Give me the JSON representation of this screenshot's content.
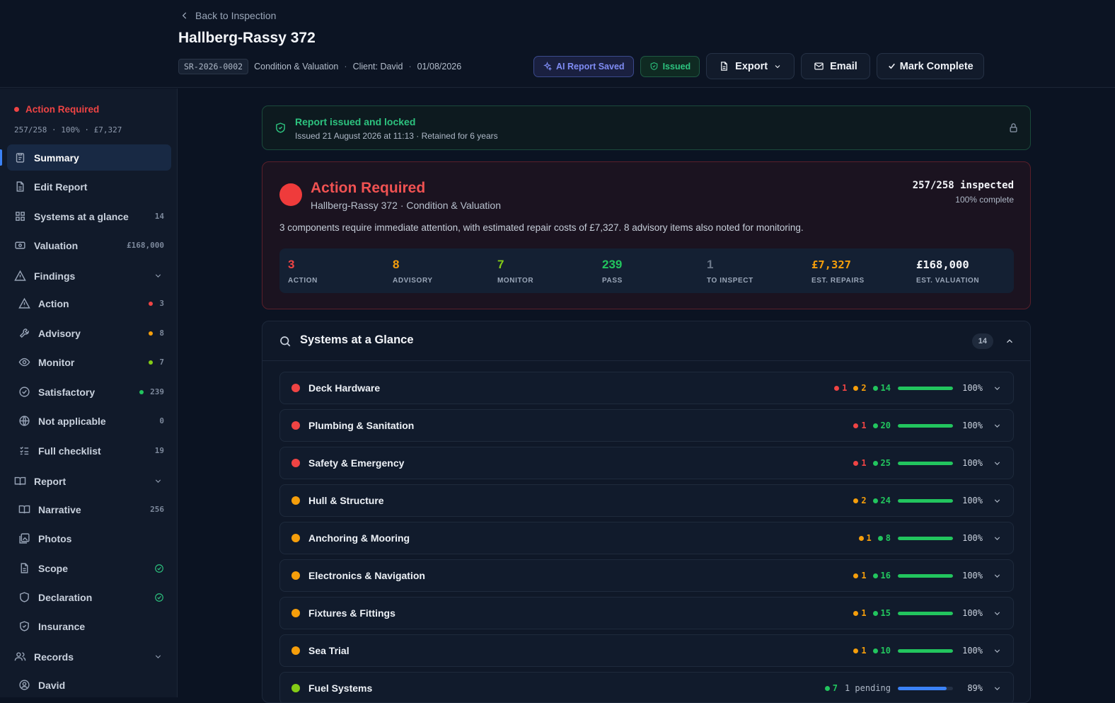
{
  "header": {
    "back_label": "Back to Inspection",
    "title": "Hallberg-Rassy 372",
    "ref": "SR-2026-0002",
    "type": "Condition & Valuation",
    "client": "Client: David",
    "date": "01/08/2026",
    "ai_badge": "AI Report Saved",
    "issued_badge": "Issued",
    "export_label": "Export",
    "email_label": "Email",
    "complete_label": "Mark Complete"
  },
  "sidebar": {
    "status": "Action Required",
    "stats": "257/258 · 100% · £7,327",
    "items": {
      "summary": "Summary",
      "edit": "Edit Report",
      "systems": "Systems at a glance",
      "systems_count": "14",
      "valuation": "Valuation",
      "valuation_amount": "£168,000",
      "findings": "Findings",
      "action": "Action",
      "action_count": "3",
      "advisory": "Advisory",
      "advisory_count": "8",
      "monitor": "Monitor",
      "monitor_count": "7",
      "satisfactory": "Satisfactory",
      "satisfactory_count": "239",
      "na": "Not applicable",
      "na_count": "0",
      "checklist": "Full checklist",
      "checklist_count": "19",
      "report": "Report",
      "narrative": "Narrative",
      "narrative_count": "256",
      "photos": "Photos",
      "scope": "Scope",
      "declaration": "Declaration",
      "insurance": "Insurance",
      "records": "Records",
      "david": "David"
    }
  },
  "banner": {
    "title": "Report issued and locked",
    "detail": "Issued 21 August 2026 at 11:13 · Retained for 6 years"
  },
  "summary": {
    "heading": "Action Required",
    "sub": "Hallberg-Rassy 372 · Condition & Valuation",
    "inspected": "257/258 inspected",
    "complete": "100% complete",
    "description": "3 components require immediate attention, with estimated repair costs of £7,327. 8 advisory items also noted for monitoring.",
    "stats": [
      {
        "value": "3",
        "label": "ACTION",
        "color": "#ef4444"
      },
      {
        "value": "8",
        "label": "ADVISORY",
        "color": "#f59e0b"
      },
      {
        "value": "7",
        "label": "MONITOR",
        "color": "#84cc16"
      },
      {
        "value": "239",
        "label": "PASS",
        "color": "#22c55e"
      },
      {
        "value": "1",
        "label": "TO INSPECT",
        "color": "#6b7789"
      },
      {
        "value": "£7,327",
        "label": "EST. REPAIRS",
        "color": "#f59e0b"
      },
      {
        "value": "£168,000",
        "label": "EST. VALUATION",
        "color": "#f4f6fa"
      }
    ]
  },
  "systems": {
    "title": "Systems at a Glance",
    "count": "14",
    "rows": [
      {
        "name": "Deck Hardware",
        "status": "#ef4444",
        "red": "1",
        "amber": "2",
        "green": "14",
        "progress": 100,
        "pct": "100%"
      },
      {
        "name": "Plumbing & Sanitation",
        "status": "#ef4444",
        "red": "1",
        "amber": "",
        "green": "20",
        "progress": 100,
        "pct": "100%"
      },
      {
        "name": "Safety & Emergency",
        "status": "#ef4444",
        "red": "1",
        "amber": "",
        "green": "25",
        "progress": 100,
        "pct": "100%"
      },
      {
        "name": "Hull & Structure",
        "status": "#f59e0b",
        "red": "",
        "amber": "2",
        "green": "24",
        "progress": 100,
        "pct": "100%"
      },
      {
        "name": "Anchoring & Mooring",
        "status": "#f59e0b",
        "red": "",
        "amber": "1",
        "green": "8",
        "progress": 100,
        "pct": "100%"
      },
      {
        "name": "Electronics & Navigation",
        "status": "#f59e0b",
        "red": "",
        "amber": "1",
        "green": "16",
        "progress": 100,
        "pct": "100%"
      },
      {
        "name": "Fixtures & Fittings",
        "status": "#f59e0b",
        "red": "",
        "amber": "1",
        "green": "15",
        "progress": 100,
        "pct": "100%"
      },
      {
        "name": "Sea Trial",
        "status": "#f59e0b",
        "red": "",
        "amber": "1",
        "green": "10",
        "progress": 100,
        "pct": "100%"
      },
      {
        "name": "Fuel Systems",
        "status": "#84cc16",
        "red": "",
        "amber": "",
        "green": "7",
        "pending": "1 pending",
        "progress": 89,
        "pct": "89%"
      }
    ]
  }
}
